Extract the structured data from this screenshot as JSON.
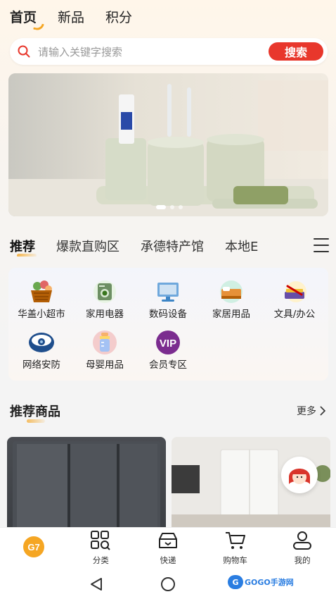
{
  "top_tabs": [
    {
      "label": "首页",
      "active": true
    },
    {
      "label": "新品",
      "active": false
    },
    {
      "label": "积分",
      "active": false
    }
  ],
  "search": {
    "placeholder": "请输入关键字搜索",
    "button_label": "搜索"
  },
  "banner": {
    "slides": 3,
    "active_slide": 1
  },
  "category_tabs": [
    {
      "label": "推荐",
      "active": true
    },
    {
      "label": "爆款直购区",
      "active": false
    },
    {
      "label": "承德特产馆",
      "active": false
    },
    {
      "label": "本地E",
      "active": false
    }
  ],
  "grid": [
    {
      "label": "华盖小超市",
      "icon": "grocery-basket-icon"
    },
    {
      "label": "家用电器",
      "icon": "washing-machine-icon"
    },
    {
      "label": "数码设备",
      "icon": "computer-monitor-icon"
    },
    {
      "label": "家居用品",
      "icon": "bed-icon"
    },
    {
      "label": "文具/办公",
      "icon": "stationery-icon"
    },
    {
      "label": "网络安防",
      "icon": "security-camera-icon"
    },
    {
      "label": "母婴用品",
      "icon": "baby-bottle-icon"
    },
    {
      "label": "会员专区",
      "icon": "vip-icon"
    }
  ],
  "recommend": {
    "title": "推荐商品",
    "more_label": "更多"
  },
  "bottom_nav": [
    {
      "label": "",
      "icon": "home-logo-icon"
    },
    {
      "label": "分类",
      "icon": "category-icon"
    },
    {
      "label": "快递",
      "icon": "delivery-icon"
    },
    {
      "label": "购物车",
      "icon": "cart-icon"
    },
    {
      "label": "我的",
      "icon": "profile-icon"
    }
  ],
  "watermark": "GOGO手游网",
  "colors": {
    "accent": "#e8372c",
    "highlight": "#f5a623"
  }
}
